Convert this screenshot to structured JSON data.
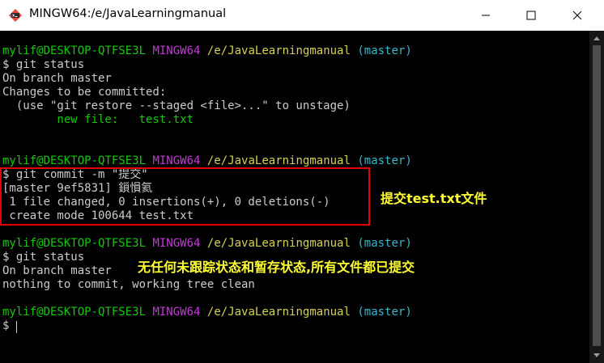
{
  "window": {
    "title": "MINGW64:/e/JavaLearningmanual",
    "icon": "git-bash-icon",
    "controls": [
      "minimize-icon",
      "maximize-icon",
      "close-icon"
    ]
  },
  "colors": {
    "background": "#000000",
    "text": "#cccccc",
    "user_host": "#16c60c",
    "mingw": "#c23bd6",
    "path": "#d6d14e",
    "branch": "#3ab7c7",
    "highlight_border": "#e50000",
    "annotation": "#ffff33"
  },
  "prompt": {
    "user_host": "mylif@DESKTOP-QTFSE3L",
    "env": "MINGW64",
    "path": "/e/JavaLearningmanual",
    "branch": "(master)"
  },
  "lines": {
    "cmd1": "$ git status",
    "out1_1": "On branch master",
    "out1_2": "Changes to be committed:",
    "out1_3": "  (use \"git restore --staged <file>...\" to unstage)",
    "out1_4_label": "        new file:   ",
    "out1_4_file": "test.txt",
    "cmd2": "$ git commit -m \"提交\"",
    "out2_1": "[master 9ef5831] 鎻愪氦",
    "out2_2": " 1 file changed, 0 insertions(+), 0 deletions(-)",
    "out2_3": " create mode 100644 test.txt",
    "cmd3": "$ git status",
    "out3_1": "On branch master",
    "out3_2": "nothing to commit, working tree clean",
    "cmd4": "$ "
  },
  "annotations": {
    "commit_note": "提交test.txt文件",
    "status_note": "无任何未跟踪状态和暂存状态,所有文件都已提交"
  }
}
